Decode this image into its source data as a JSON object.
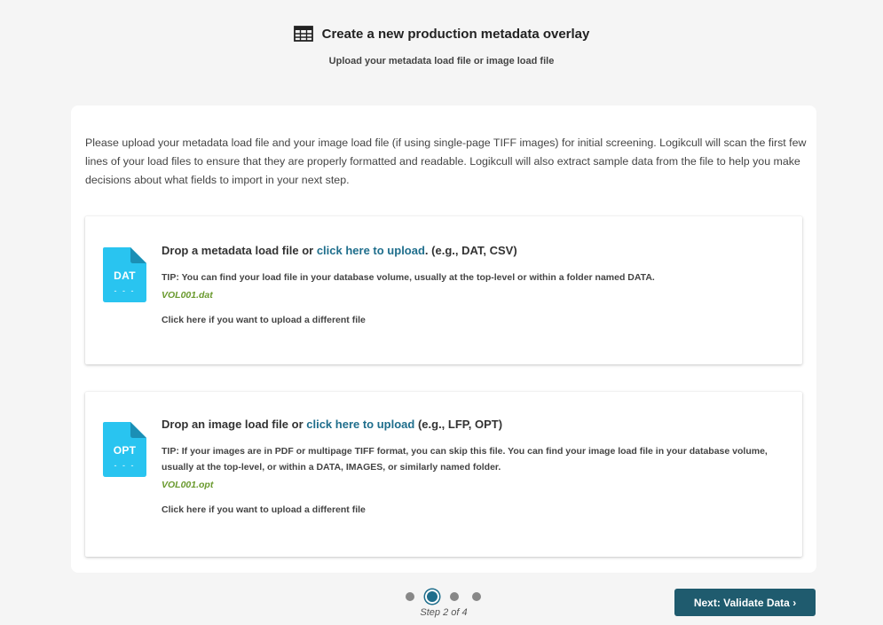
{
  "header": {
    "icon": "table-grid-icon",
    "title": "Create a new production metadata overlay",
    "subtitle": "Upload your metadata load file or image load file"
  },
  "intro": "Please upload your metadata load file and your image load file (if using single-page TIFF images) for initial screening. Logikcull will scan the first few lines of your load files to ensure that they are properly formatted and readable. Logikcull will also extract sample data from the file to help you make decisions about what fields to import in your next step.",
  "metadata_drop": {
    "icon": "file-icon",
    "ext": "DAT",
    "dashes": "- - -",
    "prefix": "Drop a metadata load file or ",
    "link": "click here to upload",
    "suffix": ". (e.g., DAT, CSV)",
    "tip_label": "TIP:",
    "tip": " You can find your load file in your database volume, usually at the top-level or within a folder named DATA.",
    "filename": "VOL001.dat",
    "reupload": "Click here if you want to upload a different file"
  },
  "image_drop": {
    "icon": "file-icon",
    "ext": "OPT",
    "dashes": "- - -",
    "prefix": "Drop an image load file or ",
    "link": "click here to upload",
    "suffix": " (e.g., LFP, OPT)",
    "tip_label": "TIP:",
    "tip": " If your images are in PDF or multipage TIFF format, you can skip this file. You can find your image load file in your database volume, usually at the top-level, or within a DATA, IMAGES, or similarly named folder.",
    "filename": "VOL001.opt",
    "reupload": "Click here if you want to upload a different file"
  },
  "pager": {
    "current": 2,
    "total": 4,
    "label": "Step 2 of 4"
  },
  "next_button": "Next: Validate Data ›",
  "colors": {
    "accent": "#1f6e8c",
    "button": "#1f5b6e",
    "file_icon": "#29c4f0",
    "filename": "#6a9a2e"
  }
}
